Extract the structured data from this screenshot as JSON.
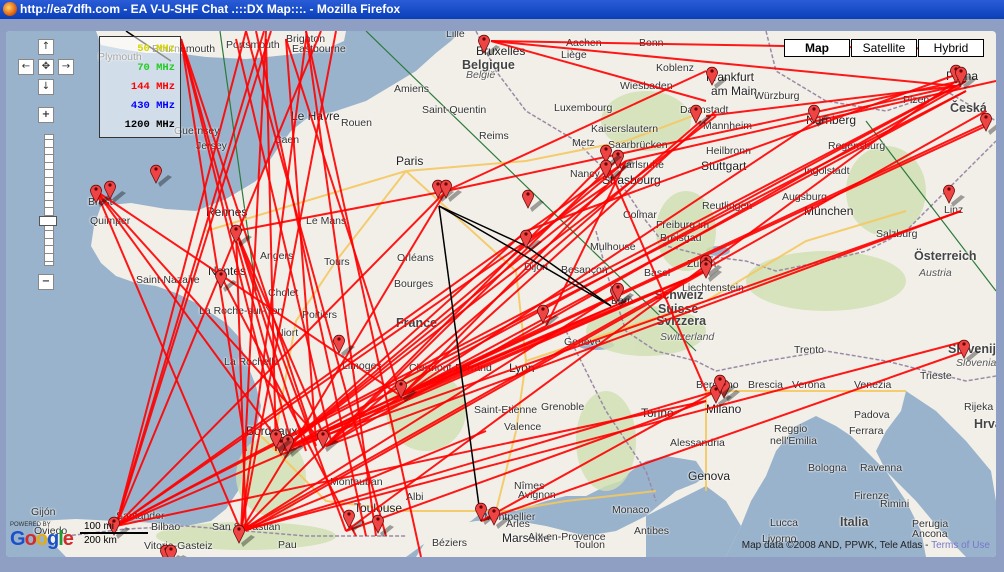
{
  "window": {
    "title": "http://ea7dfh.com - EA V-U-SHF Chat .:::DX Map:::. - Mozilla Firefox"
  },
  "map_types": [
    {
      "label": "Map",
      "active": true
    },
    {
      "label": "Satellite",
      "active": false
    },
    {
      "label": "Hybrid",
      "active": false
    }
  ],
  "legend": [
    {
      "label": "50 MHz",
      "color": "#d4d400"
    },
    {
      "label": "70 MHz",
      "color": "#22cc22"
    },
    {
      "label": "144 MHz",
      "color": "#ff0000"
    },
    {
      "label": "430 MHz",
      "color": "#0000ff"
    },
    {
      "label": "1200 MHz",
      "color": "#000000"
    }
  ],
  "scale": {
    "top_label": "100 mi",
    "bottom_label": "200 km"
  },
  "attribution": {
    "text": "Map data ©2008 AND, PPWK, Tele Atlas -",
    "link": "Terms of Use"
  },
  "google": {
    "powered": "POWERED BY",
    "logo": "Google"
  },
  "nav_icons": {
    "up": "arrow-up",
    "down": "arrow-down",
    "left": "arrow-left",
    "right": "arrow-right",
    "center": "center-cross",
    "zoom_in": "plus",
    "zoom_out": "minus"
  },
  "cities": [
    {
      "name": "Plymouth",
      "cls": ""
    },
    {
      "name": "Bournemouth",
      "cls": ""
    },
    {
      "name": "Portsmouth",
      "cls": ""
    },
    {
      "name": "Brighton",
      "cls": ""
    },
    {
      "name": "Eastbourne",
      "cls": ""
    },
    {
      "name": "Lille",
      "cls": ""
    },
    {
      "name": "Bruxelles",
      "cls": "big"
    },
    {
      "name": "Belgique",
      "cls": "country"
    },
    {
      "name": "België",
      "cls": "italic"
    },
    {
      "name": "Liège",
      "cls": ""
    },
    {
      "name": "Aachen",
      "cls": ""
    },
    {
      "name": "Bonn",
      "cls": ""
    },
    {
      "name": "Koblenz",
      "cls": ""
    },
    {
      "name": "Wiesbaden",
      "cls": ""
    },
    {
      "name": "Frankfurt",
      "cls": "big"
    },
    {
      "name": "am Main",
      "cls": "big"
    },
    {
      "name": "Darmstadt",
      "cls": ""
    },
    {
      "name": "Würzburg",
      "cls": ""
    },
    {
      "name": "Nürnberg",
      "cls": "big"
    },
    {
      "name": "Praha",
      "cls": "big"
    },
    {
      "name": "Plzeň",
      "cls": ""
    },
    {
      "name": "Česká",
      "cls": "country"
    },
    {
      "name": "Amiens",
      "cls": ""
    },
    {
      "name": "Saint-Quentin",
      "cls": ""
    },
    {
      "name": "Luxembourg",
      "cls": ""
    },
    {
      "name": "Kaiserslautern",
      "cls": ""
    },
    {
      "name": "Mannheim",
      "cls": ""
    },
    {
      "name": "Heilbronn",
      "cls": ""
    },
    {
      "name": "Regensburg",
      "cls": ""
    },
    {
      "name": "Le Havre",
      "cls": "big"
    },
    {
      "name": "Rouen",
      "cls": ""
    },
    {
      "name": "Caen",
      "cls": ""
    },
    {
      "name": "Guernsey",
      "cls": ""
    },
    {
      "name": "Jersey",
      "cls": ""
    },
    {
      "name": "Reims",
      "cls": ""
    },
    {
      "name": "Metz",
      "cls": ""
    },
    {
      "name": "Saarbrücken",
      "cls": ""
    },
    {
      "name": "Karlsruhe",
      "cls": ""
    },
    {
      "name": "Stuttgart",
      "cls": "big"
    },
    {
      "name": "Ingolstadt",
      "cls": ""
    },
    {
      "name": "Paris",
      "cls": "big"
    },
    {
      "name": "Nancy",
      "cls": ""
    },
    {
      "name": "Strasbourg",
      "cls": "big"
    },
    {
      "name": "Augsburg",
      "cls": ""
    },
    {
      "name": "Brest",
      "cls": ""
    },
    {
      "name": "Reutlingen",
      "cls": ""
    },
    {
      "name": "München",
      "cls": "big"
    },
    {
      "name": "Linz",
      "cls": ""
    },
    {
      "name": "Rennes",
      "cls": "big"
    },
    {
      "name": "Le Mans",
      "cls": ""
    },
    {
      "name": "Quimper",
      "cls": ""
    },
    {
      "name": "Colmar",
      "cls": ""
    },
    {
      "name": "Freiburg im",
      "cls": ""
    },
    {
      "name": "Breisgau",
      "cls": ""
    },
    {
      "name": "Salzburg",
      "cls": ""
    },
    {
      "name": "Orléans",
      "cls": ""
    },
    {
      "name": "Mulhouse",
      "cls": ""
    },
    {
      "name": "Angers",
      "cls": ""
    },
    {
      "name": "Tours",
      "cls": ""
    },
    {
      "name": "Dijon",
      "cls": ""
    },
    {
      "name": "Basel",
      "cls": ""
    },
    {
      "name": "Zürich",
      "cls": ""
    },
    {
      "name": "Österreich",
      "cls": "country"
    },
    {
      "name": "Austria",
      "cls": "italic"
    },
    {
      "name": "Nantes",
      "cls": "big"
    },
    {
      "name": "Besançon",
      "cls": ""
    },
    {
      "name": "Liechtenstein",
      "cls": ""
    },
    {
      "name": "Saint-Nazaire",
      "cls": ""
    },
    {
      "name": "Cholet",
      "cls": ""
    },
    {
      "name": "Bourges",
      "cls": ""
    },
    {
      "name": "Schweiz",
      "cls": "country"
    },
    {
      "name": "Bern",
      "cls": ""
    },
    {
      "name": "Suisse",
      "cls": "country"
    },
    {
      "name": "Svizzera",
      "cls": "country"
    },
    {
      "name": "Switzerland",
      "cls": "italic"
    },
    {
      "name": "La Roche-sur-Yon",
      "cls": ""
    },
    {
      "name": "Poitiers",
      "cls": ""
    },
    {
      "name": "France",
      "cls": "country"
    },
    {
      "name": "Niort",
      "cls": ""
    },
    {
      "name": "Genève",
      "cls": ""
    },
    {
      "name": "Trento",
      "cls": ""
    },
    {
      "name": "Slovenija",
      "cls": "country"
    },
    {
      "name": "Slovenia",
      "cls": "italic"
    },
    {
      "name": "La Rochelle",
      "cls": ""
    },
    {
      "name": "Limoges",
      "cls": ""
    },
    {
      "name": "Clermont-Ferrand",
      "cls": ""
    },
    {
      "name": "Lyon",
      "cls": "big"
    },
    {
      "name": "Bergamo",
      "cls": ""
    },
    {
      "name": "Brescia",
      "cls": ""
    },
    {
      "name": "Verona",
      "cls": ""
    },
    {
      "name": "Venezia",
      "cls": ""
    },
    {
      "name": "Trieste",
      "cls": ""
    },
    {
      "name": "Rijeka",
      "cls": ""
    },
    {
      "name": "Milano",
      "cls": "big"
    },
    {
      "name": "Saint-Etienne",
      "cls": ""
    },
    {
      "name": "Grenoble",
      "cls": ""
    },
    {
      "name": "Torino",
      "cls": "big"
    },
    {
      "name": "Padova",
      "cls": ""
    },
    {
      "name": "Hrva",
      "cls": "country"
    },
    {
      "name": "Bordeaux",
      "cls": "big"
    },
    {
      "name": "Valence",
      "cls": ""
    },
    {
      "name": "Alessandria",
      "cls": ""
    },
    {
      "name": "Reggio",
      "cls": ""
    },
    {
      "name": "nell'Emilia",
      "cls": ""
    },
    {
      "name": "Ferrara",
      "cls": ""
    },
    {
      "name": "Bologna",
      "cls": ""
    },
    {
      "name": "Ravenna",
      "cls": ""
    },
    {
      "name": "Genova",
      "cls": "big"
    },
    {
      "name": "Montauban",
      "cls": ""
    },
    {
      "name": "Nîmes",
      "cls": ""
    },
    {
      "name": "Avignon",
      "cls": ""
    },
    {
      "name": "Firenze",
      "cls": ""
    },
    {
      "name": "Rimini",
      "cls": ""
    },
    {
      "name": "Albi",
      "cls": ""
    },
    {
      "name": "Gijón",
      "cls": ""
    },
    {
      "name": "Santander",
      "cls": ""
    },
    {
      "name": "Toulouse",
      "cls": "big"
    },
    {
      "name": "Montpellier",
      "cls": ""
    },
    {
      "name": "Arles",
      "cls": ""
    },
    {
      "name": "Monaco",
      "cls": ""
    },
    {
      "name": "Perugia",
      "cls": ""
    },
    {
      "name": "Bilbao",
      "cls": ""
    },
    {
      "name": "San Sebastián",
      "cls": ""
    },
    {
      "name": "Lucca",
      "cls": ""
    },
    {
      "name": "Italia",
      "cls": "country"
    },
    {
      "name": "Ancona",
      "cls": ""
    },
    {
      "name": "Oviedo",
      "cls": ""
    },
    {
      "name": "Pau",
      "cls": ""
    },
    {
      "name": "Marseille",
      "cls": "big"
    },
    {
      "name": "Aix-en-Provence",
      "cls": ""
    },
    {
      "name": "Antibes",
      "cls": ""
    },
    {
      "name": "Livorno",
      "cls": ""
    },
    {
      "name": "Vitoria-Gasteiz",
      "cls": ""
    },
    {
      "name": "Béziers",
      "cls": ""
    },
    {
      "name": "Toulon",
      "cls": ""
    }
  ]
}
